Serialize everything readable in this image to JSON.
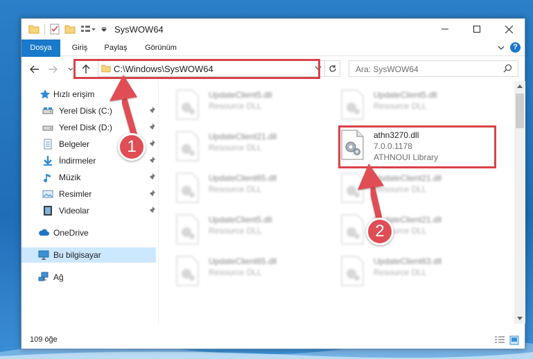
{
  "window": {
    "title": "SysWOW64",
    "minimize": "minimize",
    "maximize": "maximize",
    "close": "close"
  },
  "ribbon": {
    "tabs": [
      "Dosya",
      "Giriş",
      "Paylaş",
      "Görünüm"
    ]
  },
  "address": {
    "path": "C:\\Windows\\SysWOW64"
  },
  "search": {
    "placeholder": "Ara: SysWOW64"
  },
  "sidebar": {
    "items": [
      {
        "label": "Hızlı erişim",
        "icon": "star-icon"
      },
      {
        "label": "Yerel Disk (C:)",
        "icon": "drive-icon",
        "pinned": true
      },
      {
        "label": "Yerel Disk (D:)",
        "icon": "drive-icon",
        "pinned": true
      },
      {
        "label": "Belgeler",
        "icon": "documents-icon",
        "pinned": true
      },
      {
        "label": "İndirmeler",
        "icon": "download-icon",
        "pinned": true
      },
      {
        "label": "Müzik",
        "icon": "music-icon",
        "pinned": true
      },
      {
        "label": "Resimler",
        "icon": "pictures-icon",
        "pinned": true
      },
      {
        "label": "Videolar",
        "icon": "videos-icon",
        "pinned": true
      },
      {
        "label": "OneDrive",
        "icon": "cloud-icon"
      },
      {
        "label": "Bu bilgisayar",
        "icon": "computer-icon",
        "selected": true
      },
      {
        "label": "Ağ",
        "icon": "network-icon"
      }
    ]
  },
  "files": [
    {
      "name": "UpdateClient5.dll",
      "type": "Resource DLL",
      "blurred": true
    },
    {
      "name": "UpdateClient5.dll",
      "type": "Resource DLL",
      "blurred": true
    },
    {
      "name": "UpdateClient21.dll",
      "type": "Resource DLL",
      "blurred": true
    },
    {
      "name": "athn3270.dll",
      "type": "7.0.0.1178",
      "description": "ATHNOUI Library",
      "blurred": false,
      "highlighted": true
    },
    {
      "name": "UpdateClient65.dll",
      "type": "Resource DLL",
      "blurred": true
    },
    {
      "name": "UpdateClient21.dll",
      "type": "Resource DLL",
      "blurred": true
    },
    {
      "name": "UpdateClient5.dll",
      "type": "Resource DLL",
      "blurred": true
    },
    {
      "name": "UpdateClient21.dll",
      "type": "Resource DLL",
      "blurred": true
    },
    {
      "name": "UpdateClient65.dll",
      "type": "Resource DLL",
      "blurred": true
    },
    {
      "name": "UpdateClient63.dll",
      "type": "Resource DLL",
      "blurred": true
    }
  ],
  "annotations": {
    "step1": "1",
    "step2": "2",
    "highlight_color": "#d9424a"
  },
  "status": {
    "count": "109 öğe"
  },
  "colors": {
    "accent": "#1979ca",
    "selection": "#cce8ff"
  }
}
